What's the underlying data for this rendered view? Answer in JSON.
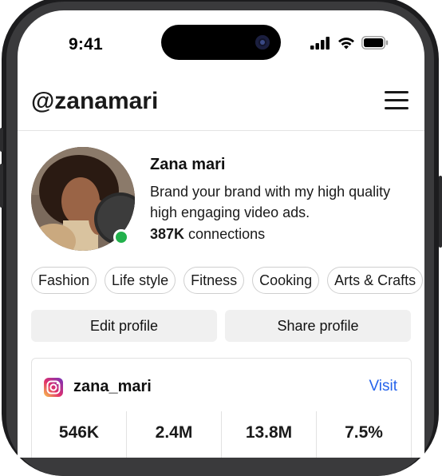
{
  "status_bar": {
    "time": "9:41",
    "icons": [
      "signal-icon",
      "wifi-icon",
      "battery-icon"
    ]
  },
  "header": {
    "username": "@zanamari",
    "menu_icon": "menu-icon"
  },
  "profile": {
    "name": "Zana mari",
    "bio": "Brand your brand with my high quality high engaging video ads.",
    "connections_count": "387K",
    "connections_label": " connections",
    "online": true
  },
  "tags": [
    "Fashion",
    "Life style",
    "Fitness",
    "Cooking",
    "Arts & Crafts"
  ],
  "actions": {
    "edit_label": "Edit profile",
    "share_label": "Share profile"
  },
  "social_card": {
    "platform_icon": "instagram-icon",
    "handle": "zana_mari",
    "visit_label": "Visit",
    "stats": [
      "546K",
      "2.4M",
      "13.8M",
      "7.5%"
    ]
  },
  "colors": {
    "accent": "#2563eb",
    "online": "#22b14c",
    "button_bg": "#f0f0f0"
  }
}
